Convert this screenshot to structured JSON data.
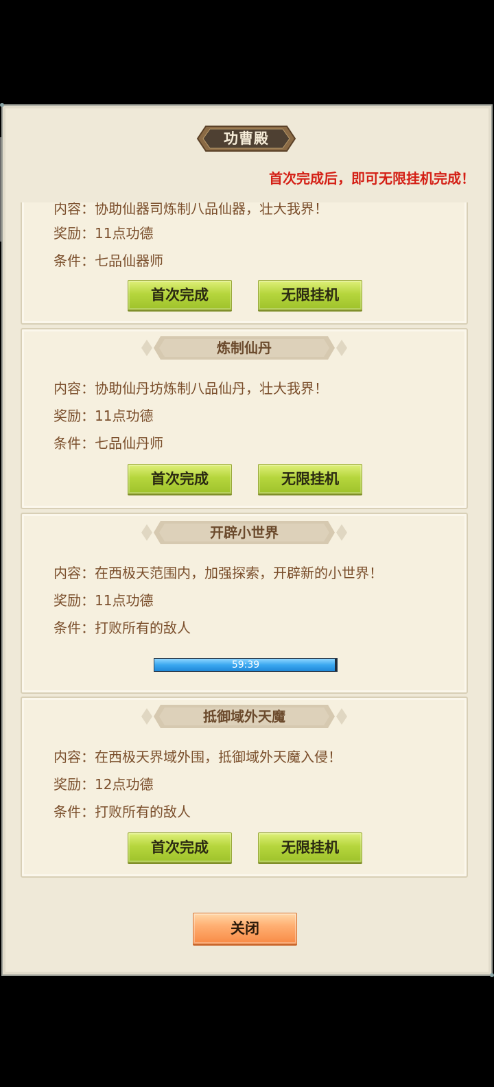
{
  "header": {
    "title": "功曹殿",
    "notice": "首次完成后，即可无限挂机完成！"
  },
  "tasks": [
    {
      "content": "内容：协助仙器司炼制八品仙器，壮大我界！",
      "reward": "奖励：11点功德",
      "condition": "条件：七品仙器师",
      "first_label": "首次完成",
      "idle_label": "无限挂机"
    },
    {
      "title": "炼制仙丹",
      "content": "内容：协助仙丹坊炼制八品仙丹，壮大我界！",
      "reward": "奖励：11点功德",
      "condition": "条件：七品仙丹师",
      "first_label": "首次完成",
      "idle_label": "无限挂机"
    },
    {
      "title": "开辟小世界",
      "content": "内容：在西极天范围内，加强探索，开辟新的小世界！",
      "reward": "奖励：11点功德",
      "condition": "条件：打败所有的敌人",
      "timer": "59:39",
      "progress": 0.99
    },
    {
      "title": "抵御域外天魔",
      "content": "内容：在西极天界域外围，抵御域外天魔入侵！",
      "reward": "奖励：12点功德",
      "condition": "条件：打败所有的敌人",
      "first_label": "首次完成",
      "idle_label": "无限挂机"
    }
  ],
  "footer": {
    "close_label": "关闭"
  },
  "colors": {
    "panel_bg": "#efe9d8",
    "card_bg": "#f6f0df",
    "text_brown": "#7a4e2b",
    "notice_red": "#d41f15",
    "button_green": "#b6d63d",
    "close_orange": "#f88a45",
    "progress_blue": "#3aa8f0"
  }
}
